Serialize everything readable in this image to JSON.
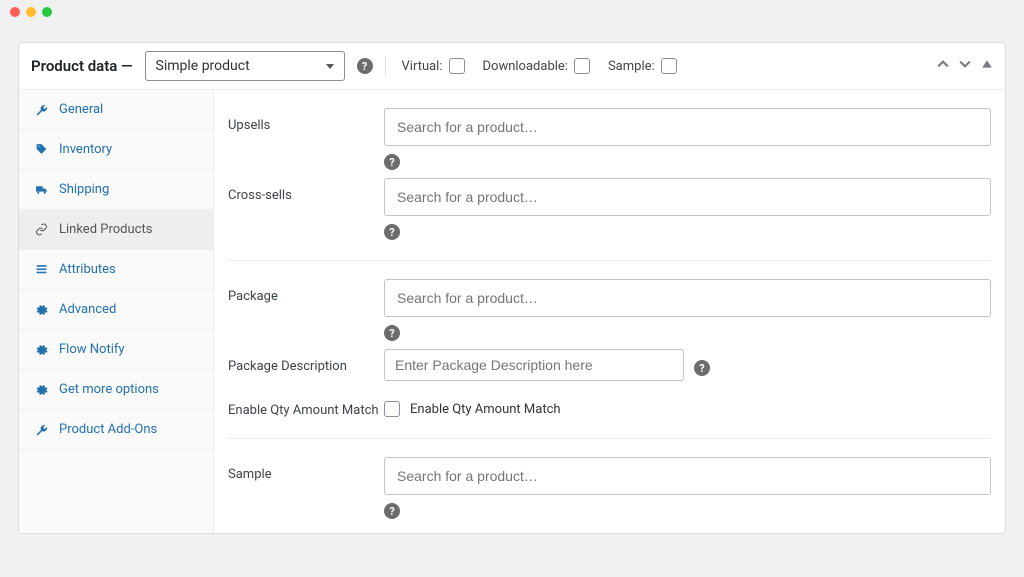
{
  "header": {
    "title": "Product data —",
    "product_type": "Simple product",
    "checks": {
      "virtual_label": "Virtual:",
      "downloadable_label": "Downloadable:",
      "sample_label": "Sample:"
    }
  },
  "sidebar": {
    "items": [
      {
        "label": "General",
        "icon": "wrench"
      },
      {
        "label": "Inventory",
        "icon": "tag"
      },
      {
        "label": "Shipping",
        "icon": "truck"
      },
      {
        "label": "Linked Products",
        "icon": "link",
        "active": true
      },
      {
        "label": "Attributes",
        "icon": "list"
      },
      {
        "label": "Advanced",
        "icon": "gear"
      },
      {
        "label": "Flow Notify",
        "icon": "gear"
      },
      {
        "label": "Get more options",
        "icon": "gear"
      },
      {
        "label": "Product Add-Ons",
        "icon": "wrench"
      }
    ]
  },
  "fields": {
    "upsells": {
      "label": "Upsells",
      "placeholder": "Search for a product…"
    },
    "cross_sells": {
      "label": "Cross-sells",
      "placeholder": "Search for a product…"
    },
    "package": {
      "label": "Package",
      "placeholder": "Search for a product…"
    },
    "package_description": {
      "label": "Package Description",
      "placeholder": "Enter Package Description here"
    },
    "enable_qty": {
      "label": "Enable Qty Amount Match",
      "check_label": "Enable Qty Amount Match"
    },
    "sample": {
      "label": "Sample",
      "placeholder": "Search for a product…"
    }
  }
}
